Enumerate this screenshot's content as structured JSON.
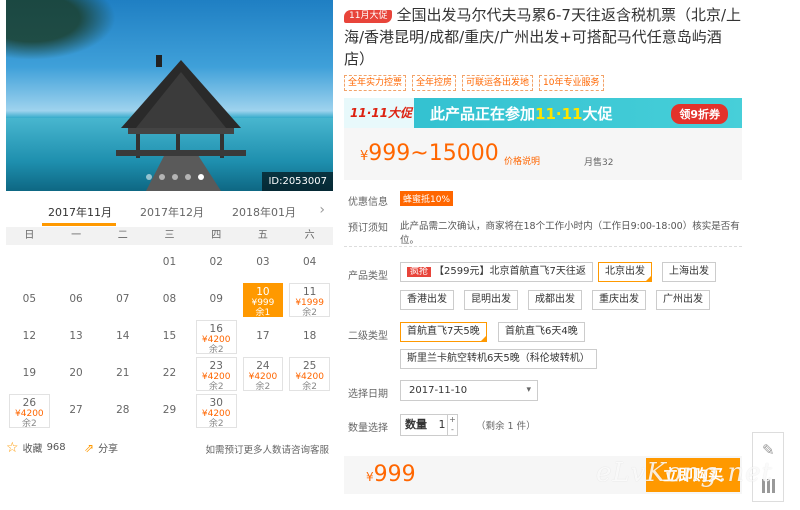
{
  "hero": {
    "id_badge": "ID:2053007",
    "dot_count": 5,
    "active_dot": 4
  },
  "calendar": {
    "tabs": [
      "2017年11月",
      "2017年12月",
      "2018年01月"
    ],
    "active_tab": 0,
    "weekdays": [
      "日",
      "一",
      "二",
      "三",
      "四",
      "五",
      "六"
    ],
    "cells": [
      {
        "day": ""
      },
      {
        "day": ""
      },
      {
        "day": ""
      },
      {
        "day": "01"
      },
      {
        "day": "02"
      },
      {
        "day": "03"
      },
      {
        "day": "04"
      },
      {
        "day": "05"
      },
      {
        "day": "06"
      },
      {
        "day": "07"
      },
      {
        "day": "08"
      },
      {
        "day": "09"
      },
      {
        "day": "10",
        "price": "¥999",
        "left": "余1",
        "selected": true
      },
      {
        "day": "11",
        "price": "¥1999",
        "left": "余2"
      },
      {
        "day": "12"
      },
      {
        "day": "13"
      },
      {
        "day": "14"
      },
      {
        "day": "15"
      },
      {
        "day": "16",
        "price": "¥4200",
        "left": "余2"
      },
      {
        "day": "17"
      },
      {
        "day": "18"
      },
      {
        "day": "19"
      },
      {
        "day": "20"
      },
      {
        "day": "21"
      },
      {
        "day": "22"
      },
      {
        "day": "23",
        "price": "¥4200",
        "left": "余2"
      },
      {
        "day": "24",
        "price": "¥4200",
        "left": "余2"
      },
      {
        "day": "25",
        "price": "¥4200",
        "left": "余2"
      },
      {
        "day": "26",
        "price": "¥4200",
        "left": "余2"
      },
      {
        "day": "27"
      },
      {
        "day": "28"
      },
      {
        "day": "29"
      },
      {
        "day": "30",
        "price": "¥4200",
        "left": "余2"
      },
      {
        "day": ""
      },
      {
        "day": ""
      }
    ]
  },
  "left_footer": {
    "fav_label": "收藏",
    "fav_count": "968",
    "share_label": "分享",
    "note": "如需预订更多人数请咨询客服"
  },
  "product": {
    "promo_tag": "11月大促",
    "title": "全国出发马尔代夫马累6-7天往返含税机票（北京/上海/香港昆明/成都/重庆/广州出发+可搭配马代任意岛屿酒店）",
    "tags": [
      "全年实力控票",
      "全年控房",
      "可联运各出发地",
      "10年专业服务"
    ]
  },
  "banner": {
    "logo": "11·11大促",
    "text_pre": "此产品正在参加",
    "text_hl": "11·11",
    "text_post": "大促",
    "btn": "领9折券"
  },
  "price": {
    "yen": "¥",
    "range": "999~15000",
    "explain": "价格说明",
    "sold": "月售32"
  },
  "info": {
    "youhui_label": "优惠信息",
    "youhui_tag": "蜂蜜抵10%",
    "notice_label": "预订须知",
    "notice": "此产品需二次确认，商家将在18个工作小时内（工作日9:00-18:00）核实是否有位。"
  },
  "options": {
    "type_label": "产品类型",
    "qiang": "疯抢",
    "types": [
      "【2599元】北京首航直飞7天往返",
      "北京出发",
      "上海出发",
      "香港出发",
      "昆明出发",
      "成都出发",
      "重庆出发",
      "广州出发"
    ],
    "selected_type": "北京出发",
    "sub_label": "二级类型",
    "subs": [
      "首航直飞7天5晚",
      "首航直飞6天4晚",
      "斯里兰卡航空转机6天5晚（科伦坡转机）"
    ],
    "selected_sub": "首航直飞7天5晚"
  },
  "date": {
    "label": "选择日期",
    "value": "2017-11-10"
  },
  "quantity": {
    "label": "数量选择",
    "qty_label": "数量",
    "qty": "1",
    "left": "（剩余 1 件）"
  },
  "buy": {
    "yen": "¥",
    "price": "999",
    "btn": "立即购买"
  },
  "watermark": "eLvKong.net",
  "colors": {
    "accent": "#ff9900",
    "price": "#ff6600",
    "banner": "#2fbfcf"
  }
}
